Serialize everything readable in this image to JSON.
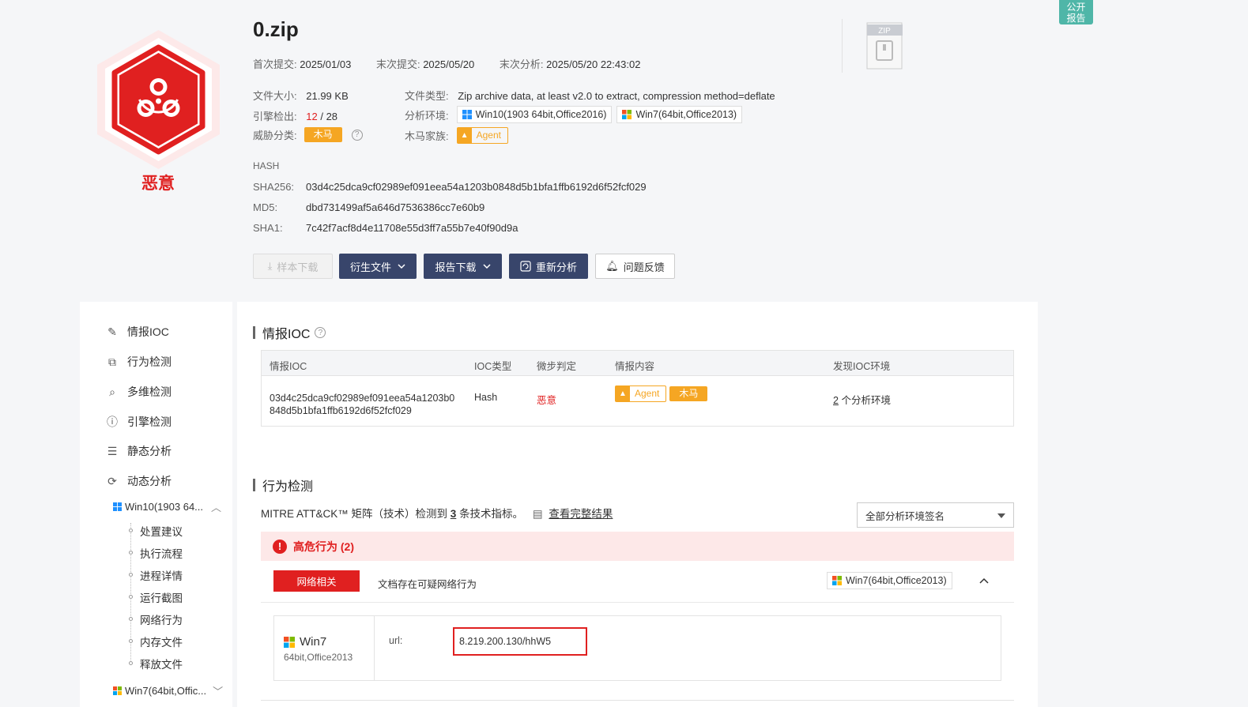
{
  "file": {
    "name": "0.zip",
    "verdict": "恶意",
    "first_submit_label": "首次提交:",
    "first_submit": "2025/01/03",
    "last_submit_label": "末次提交:",
    "last_submit": "2025/05/20",
    "last_analysis_label": "末次分析:",
    "last_analysis": "2025/05/20 22:43:02",
    "size_label": "文件大小:",
    "size": "21.99 KB",
    "type_label": "文件类型:",
    "type": "Zip archive data, at least v2.0 to extract, compression method=deflate",
    "engines_label": "引擎检出:",
    "engines_detected": "12",
    "engines_total": "/ 28",
    "env_label": "分析环境:",
    "envs": [
      "Win10(1903 64bit,Office2016)",
      "Win7(64bit,Office2013)"
    ],
    "threat_label": "威胁分类:",
    "threat": "木马",
    "family_label": "木马家族:",
    "family": "Agent",
    "zip_icon_label": "ZIP"
  },
  "hash": {
    "title": "HASH",
    "sha256_label": "SHA256:",
    "sha256": "03d4c25dca9cf02989ef091eea54a1203b0848d5b1bfa1ffb6192d6f52fcf029",
    "md5_label": "MD5:",
    "md5": "dbd731499af5a646d7536386cc7e60b9",
    "sha1_label": "SHA1:",
    "sha1": "7c42f7acf8d4e11708e55d3ff7a55b7e40f90d9a"
  },
  "actions": {
    "sample_download": "样本下载",
    "derived_files": "衍生文件",
    "report_download": "报告下载",
    "reanalyze": "重新分析",
    "feedback": "问题反馈"
  },
  "float_button": [
    "公开",
    "报告"
  ],
  "sidebar": {
    "items": [
      "情报IOC",
      "行为检测",
      "多维检测",
      "引擎检测",
      "静态分析",
      "动态分析"
    ],
    "env1": "Win10(1903 64...",
    "env1_children": [
      "处置建议",
      "执行流程",
      "进程详情",
      "运行截图",
      "网络行为",
      "内存文件",
      "释放文件"
    ],
    "env2": "Win7(64bit,Offic..."
  },
  "ioc": {
    "title": "情报IOC",
    "columns": [
      "情报IOC",
      "IOC类型",
      "微步判定",
      "情报内容",
      "发现IOC环境"
    ],
    "row": {
      "ioc_line1": "03d4c25dca9cf02989ef091eea54a1203b0",
      "ioc_line2": "848d5b1bfa1ffb6192d6f52fcf029",
      "type": "Hash",
      "verdict": "恶意",
      "tag_family": "Agent",
      "tag_threat": "木马",
      "env_count": "2",
      "env_suffix": "个分析环境"
    }
  },
  "behavior": {
    "title": "行为检测",
    "mitre_prefix": "MITRE ATT&CK™ 矩阵（技术）检测到",
    "mitre_count": "3",
    "mitre_suffix": "条技术指标。",
    "view_full": "查看完整结果",
    "select_value": "全部分析环境签名",
    "alert": "高危行为 (2)",
    "category": "网络相关",
    "description": "文档存在可疑网络行为",
    "env_tag": "Win7(64bit,Office2013)",
    "detail_os": "Win7",
    "detail_os_sub": "64bit,Office2013",
    "url_label": "url:",
    "url_value": "8.219.200.130/hhW5"
  },
  "colors": {
    "danger": "#e02020",
    "warning": "#f5a623",
    "primary_dark": "#38456b",
    "teal": "#4fb6a8"
  }
}
